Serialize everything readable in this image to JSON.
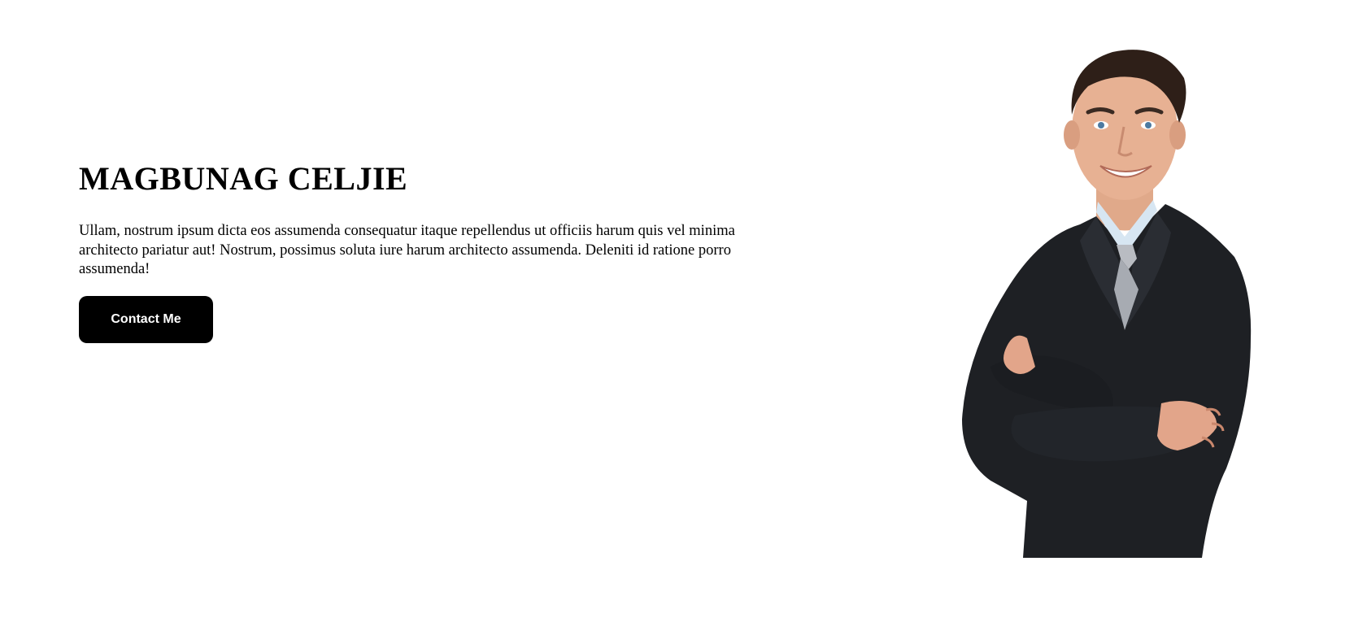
{
  "hero": {
    "title": "MAGBUNAG CELJIE",
    "description": "Ullam, nostrum ipsum dicta eos assumenda consequatur itaque repellendus ut officiis harum quis vel minima architecto pariatur aut! Nostrum, possimus soluta iure harum architecto assumenda. Deleniti id ratione porro assumenda!",
    "contact_button_label": "Contact Me"
  },
  "colors": {
    "background": "#ffffff",
    "text": "#000000",
    "button_background": "#000000",
    "button_text": "#ffffff"
  },
  "portrait": {
    "subject": "smiling man in dark suit with arms crossed"
  }
}
